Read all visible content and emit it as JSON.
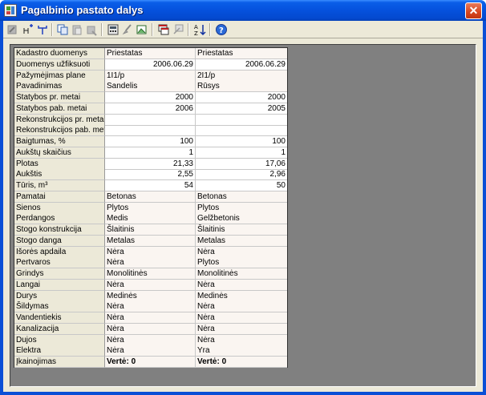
{
  "window": {
    "title": "Pagalbinio pastato dalys",
    "close_glyph": "✕"
  },
  "toolbar": {
    "icons": [
      "edit-icon",
      "tree-add-icon",
      "tree-branch-icon",
      "copy-icon",
      "paste-icon",
      "delete-icon",
      "calculator-icon",
      "brush-icon",
      "picture-icon",
      "window-list-icon",
      "window-arrow-icon",
      "sort-az-icon",
      "help-icon"
    ]
  },
  "table": {
    "rows": [
      {
        "label": "Kadastro duomenys",
        "v1": "Priestatas",
        "v2": "Priestatas",
        "kind": "text"
      },
      {
        "label": "Duomenys užfiksuoti",
        "v1": "2006.06.29",
        "v2": "2006.06.29",
        "kind": "num"
      },
      {
        "label": "Pažymėjimas plane",
        "v1": "1I1/p",
        "v2": "2I1/p",
        "kind": "text"
      },
      {
        "label": "Pavadinimas",
        "v1": "Sandelis",
        "v2": "Rūsys",
        "kind": "text"
      },
      {
        "label": "Statybos pr. metai",
        "v1": "2000",
        "v2": "2000",
        "kind": "num"
      },
      {
        "label": "Statybos pab. metai",
        "v1": "2006",
        "v2": "2005",
        "kind": "num"
      },
      {
        "label": "Rekonstrukcijos pr. metai",
        "v1": "",
        "v2": "",
        "kind": "num"
      },
      {
        "label": "Rekonstrukcijos pab. meta",
        "v1": "",
        "v2": "",
        "kind": "num"
      },
      {
        "label": "Baigtumas, %",
        "v1": "100",
        "v2": "100",
        "kind": "num"
      },
      {
        "label": "Aukštų skaičius",
        "v1": "1",
        "v2": "1",
        "kind": "num"
      },
      {
        "label": "Plotas",
        "v1": "21,33",
        "v2": "17,06",
        "kind": "num"
      },
      {
        "label": "Aukštis",
        "v1": "2,55",
        "v2": "2,96",
        "kind": "num"
      },
      {
        "label": "Tūris, m³",
        "v1": "54",
        "v2": "50",
        "kind": "num"
      },
      {
        "label": "Pamatai",
        "v1": "Betonas",
        "v2": "Betonas",
        "kind": "text"
      },
      {
        "label": "Sienos",
        "v1": "Plytos",
        "v2": "Plytos",
        "kind": "text"
      },
      {
        "label": "Perdangos",
        "v1": "Medis",
        "v2": "Gelžbetonis",
        "kind": "text"
      },
      {
        "label": "Stogo konstrukcija",
        "v1": "Šlaitinis",
        "v2": "Šlaitinis",
        "kind": "text"
      },
      {
        "label": "Stogo danga",
        "v1": "Metalas",
        "v2": "Metalas",
        "kind": "text"
      },
      {
        "label": "Išorės apdaila",
        "v1": "Nėra",
        "v2": "Nėra",
        "kind": "text"
      },
      {
        "label": "Pertvaros",
        "v1": "Nėra",
        "v2": "Plytos",
        "kind": "text"
      },
      {
        "label": "Grindys",
        "v1": "Monolitinės",
        "v2": "Monolitinės",
        "kind": "text"
      },
      {
        "label": "Langai",
        "v1": "Nėra",
        "v2": "Nėra",
        "kind": "text"
      },
      {
        "label": "Durys",
        "v1": "Medinės",
        "v2": "Medinės",
        "kind": "text"
      },
      {
        "label": "Šildymas",
        "v1": "Nėra",
        "v2": "Nėra",
        "kind": "text"
      },
      {
        "label": "Vandentiekis",
        "v1": "Nėra",
        "v2": "Nėra",
        "kind": "text"
      },
      {
        "label": "Kanalizacija",
        "v1": "Nėra",
        "v2": "Nėra",
        "kind": "text"
      },
      {
        "label": "Dujos",
        "v1": "Nėra",
        "v2": "Nėra",
        "kind": "text"
      },
      {
        "label": "Elektra",
        "v1": "Nėra",
        "v2": "Yra",
        "kind": "text"
      },
      {
        "label": "Įkainojimas",
        "v1": "Vertė: 0",
        "v2": "Vertė: 0",
        "kind": "bold"
      }
    ]
  }
}
